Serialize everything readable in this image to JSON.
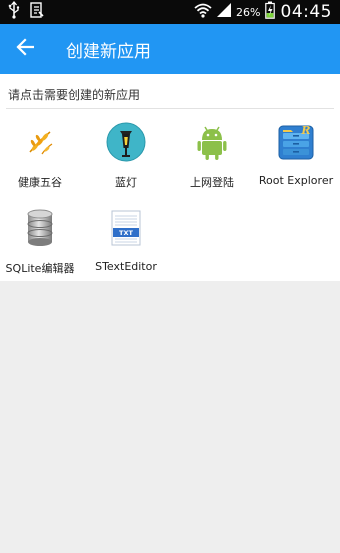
{
  "status_bar": {
    "battery": "26%",
    "time": "04:45"
  },
  "app_bar": {
    "title": "创建新应用"
  },
  "main": {
    "header": "请点击需要创建的新应用",
    "apps": [
      {
        "label": "健康五谷",
        "icon": "grain-icon"
      },
      {
        "label": "蓝灯",
        "icon": "lantern-icon"
      },
      {
        "label": "上网登陆",
        "icon": "android-icon"
      },
      {
        "label": "Root Explorer",
        "icon": "root-explorer-icon"
      },
      {
        "label": "SQLite编辑器",
        "icon": "database-icon"
      },
      {
        "label": "STextEditor",
        "icon": "txt-file-icon"
      }
    ],
    "txt_badge": "TXT",
    "root_badge": "R"
  },
  "colors": {
    "app_bar": "#2196f3",
    "status_bar": "#0a0a0a",
    "background": "#eeeeee"
  }
}
